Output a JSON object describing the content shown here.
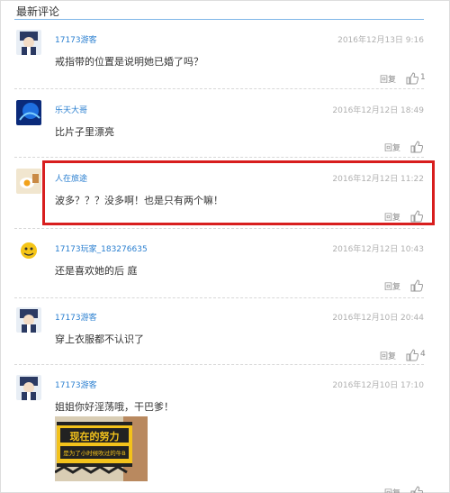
{
  "section": {
    "title": "最新评论"
  },
  "comments": [
    {
      "user": "17173游客",
      "time": "2016年12月13日 9:16",
      "text": "戒指带的位置是说明她已婚了吗？",
      "reply": "回复",
      "likes": "1"
    },
    {
      "user": "乐天大哥",
      "time": "2016年12月12日 18:49",
      "text": "比片子里漂亮",
      "reply": "回复",
      "likes": ""
    },
    {
      "user": "人在旅途",
      "time": "2016年12月12日 11:22",
      "text": "波多？？？没多啊！也是只有两个嘛！",
      "reply": "回复",
      "likes": ""
    },
    {
      "user": "17173玩家_183276635",
      "time": "2016年12月12日 10:43",
      "text": "还是喜欢她的后 庭",
      "reply": "回复",
      "likes": ""
    },
    {
      "user": "17173游客",
      "time": "2016年12月10日 20:44",
      "text": "穿上衣服都不认识了",
      "reply": "回复",
      "likes": "4"
    },
    {
      "user": "17173游客",
      "time": "2016年12月10日 17:10",
      "text": "姐姐你好淫荡哦，干巴爹！",
      "reply": "回复",
      "likes": ""
    }
  ],
  "photo_sign": {
    "line1": "现在的努力",
    "line2": "是为了小时候吹过的牛B"
  },
  "icons": {
    "like": "thumbs-up-icon"
  },
  "colors": {
    "accent": "#2a7fd0",
    "highlight": "#d81e1e"
  }
}
